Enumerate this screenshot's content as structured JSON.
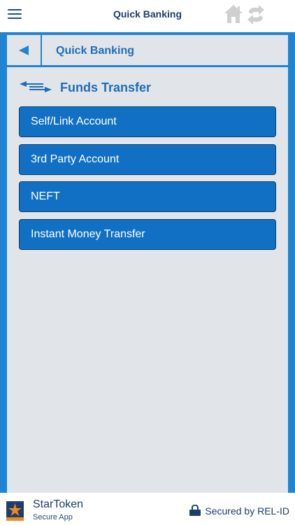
{
  "topbar": {
    "title": "Quick Banking",
    "icons": {
      "menu": "hamburger-icon",
      "home": "home-icon",
      "swap": "swap-icon"
    }
  },
  "header": {
    "title": "Quick Banking",
    "back_icon": "back-arrow-icon"
  },
  "section": {
    "title": "Funds Transfer",
    "icon": "transfer-arrows-icon"
  },
  "menu": {
    "items": [
      {
        "label": "Self/Link Account"
      },
      {
        "label": "3rd Party Account"
      },
      {
        "label": "NEFT"
      },
      {
        "label": "Instant Money Transfer"
      }
    ]
  },
  "footer": {
    "brand": "StarToken",
    "subtitle": "Secure App",
    "secured": "Secured by REL-ID"
  },
  "colors": {
    "accent": "#1f84d2",
    "button": "#1170c4",
    "title_text": "#1f6db8",
    "panel_bg": "#e1e5e9",
    "logo_orange": "#f08a1a",
    "logo_navy": "#1e3d6e"
  }
}
